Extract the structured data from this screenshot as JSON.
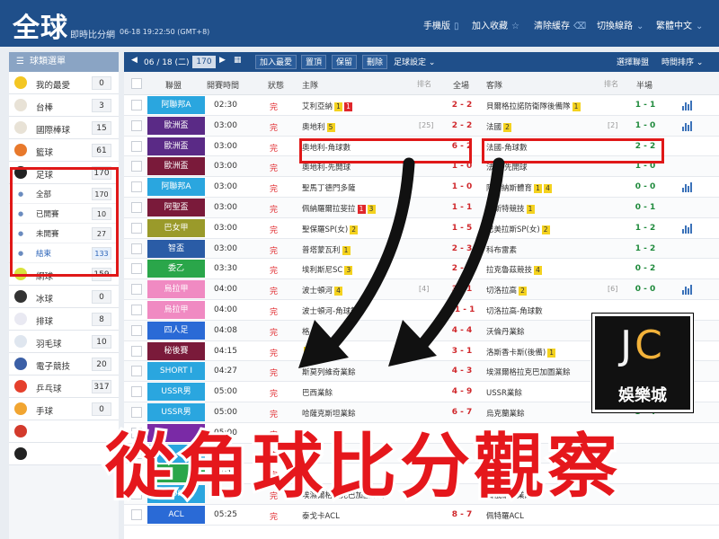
{
  "header": {
    "logo": "全球",
    "subtitle": "即時比分網",
    "datetime": "06-18 19:22:50 (GMT+8)",
    "nav": [
      {
        "label": "手機版",
        "icon": "mobile-icon"
      },
      {
        "label": "加入收藏",
        "icon": "star-icon"
      },
      {
        "label": "清除緩存",
        "icon": "clear-icon"
      },
      {
        "label": "切換線路",
        "icon": "chevron-down-icon"
      },
      {
        "label": "繁體中文",
        "icon": "chevron-down-icon"
      }
    ]
  },
  "sidebar": {
    "title": "球類選單",
    "items": [
      {
        "label": "我的最愛",
        "count": "0",
        "color": "#f3c623"
      },
      {
        "label": "台棒",
        "count": "3",
        "color": "#e8e2d6"
      },
      {
        "label": "國際棒球",
        "count": "15",
        "color": "#e8e2d6"
      },
      {
        "label": "籃球",
        "count": "61",
        "color": "#e8792c"
      },
      {
        "label": "足球",
        "count": "170",
        "color": "#222222"
      }
    ],
    "football_sub": [
      {
        "label": "全部",
        "count": "170"
      },
      {
        "label": "已開賽",
        "count": "10"
      },
      {
        "label": "未開賽",
        "count": "27"
      },
      {
        "label": "結束",
        "count": "133"
      }
    ],
    "items2": [
      {
        "label": "網球",
        "count": "159",
        "color": "#d9e23b"
      },
      {
        "label": "冰球",
        "count": "0",
        "color": "#333333"
      },
      {
        "label": "排球",
        "count": "8",
        "color": "#e9e9f2"
      },
      {
        "label": "羽毛球",
        "count": "10",
        "color": "#dfe6ef"
      },
      {
        "label": "電子競技",
        "count": "20",
        "color": "#3b5fa6"
      },
      {
        "label": "乒乓球",
        "count": "317",
        "color": "#e5402c"
      },
      {
        "label": "手球",
        "count": "0",
        "color": "#f1a531"
      },
      {
        "label": "",
        "count": "",
        "color": "#d33a2c"
      },
      {
        "label": "",
        "count": "",
        "color": "#222222"
      }
    ]
  },
  "toolbar": {
    "date": "06 / 18 (二)",
    "date_count": "170",
    "buttons": [
      "加入最愛",
      "置頂",
      "保留",
      "刪除"
    ],
    "settings": "足球設定",
    "select_league": "選擇聯盟",
    "sort": "時間排序"
  },
  "columns": {
    "league": "聯盟",
    "time": "開賽時間",
    "status": "狀態",
    "home": "主隊",
    "home_rank": "排名",
    "full": "全場",
    "away": "客隊",
    "away_rank": "排名",
    "half": "半場"
  },
  "matches": [
    {
      "league": "阿聯邦A",
      "league_color": "#2aa6df",
      "time": "02:30",
      "status": "完",
      "home": "艾利亞納",
      "home_cards": [
        {
          "t": "Y",
          "n": "1"
        },
        {
          "t": "R",
          "n": "1"
        }
      ],
      "home_rank": "",
      "score": "2 - 2",
      "away": "貝爾格拉諾防衛隊後備隊",
      "away_cards": [
        {
          "t": "Y",
          "n": "1"
        }
      ],
      "away_rank": "",
      "half": "1 - 1",
      "stat": true
    },
    {
      "league": "歐洲盃",
      "league_color": "#5a2a86",
      "time": "03:00",
      "status": "完",
      "home": "奧地利",
      "home_cards": [
        {
          "t": "Y",
          "n": "5"
        }
      ],
      "home_rank": "[25]",
      "score": "2 - 2",
      "away": "法國",
      "away_cards": [
        {
          "t": "Y",
          "n": "2"
        }
      ],
      "away_rank": "[2]",
      "half": "1 - 0",
      "stat": true
    },
    {
      "league": "歐洲盃",
      "league_color": "#5a2a86",
      "time": "03:00",
      "status": "完",
      "home": "奧地利-角球數",
      "home_cards": [],
      "home_rank": "",
      "score": "6 - 2",
      "away": "法國-角球數",
      "away_cards": [],
      "away_rank": "",
      "half": "2 - 2",
      "stat": false
    },
    {
      "league": "歐洲盃",
      "league_color": "#7a1a3a",
      "time": "03:00",
      "status": "完",
      "home": "奧地利-先開球",
      "home_cards": [],
      "home_rank": "",
      "score": "1 - 0",
      "away": "法國-先開球",
      "away_cards": [],
      "away_rank": "",
      "half": "1 - 0",
      "stat": false
    },
    {
      "league": "阿聯邦A",
      "league_color": "#2aa6df",
      "time": "03:00",
      "status": "完",
      "home": "聖馬丁德門多薩",
      "home_cards": [],
      "home_rank": "",
      "score": "1 - 0",
      "away": "阿爾納斯體育",
      "away_cards": [
        {
          "t": "Y",
          "n": "1"
        },
        {
          "t": "Y",
          "n": "4"
        }
      ],
      "away_rank": "",
      "half": "0 - 0",
      "stat": true
    },
    {
      "league": "阿聖盃",
      "league_color": "#7a1a3a",
      "time": "03:00",
      "status": "完",
      "home": "佩納羅爾拉斐拉",
      "home_cards": [
        {
          "t": "R",
          "n": "1"
        },
        {
          "t": "Y",
          "n": "3"
        }
      ],
      "home_rank": "",
      "score": "1 - 1",
      "away": "阿斯特競技",
      "away_cards": [
        {
          "t": "Y",
          "n": "1"
        }
      ],
      "away_rank": "",
      "half": "0 - 1",
      "stat": false
    },
    {
      "league": "巴女甲",
      "league_color": "#9a9a2a",
      "time": "03:00",
      "status": "完",
      "home": "聖保羅SP(女)",
      "home_cards": [
        {
          "t": "Y",
          "n": "2"
        }
      ],
      "home_rank": "",
      "score": "1 - 5",
      "away": "巴美拉斯SP(女)",
      "away_cards": [
        {
          "t": "Y",
          "n": "2"
        }
      ],
      "away_rank": "",
      "half": "1 - 2",
      "stat": true
    },
    {
      "league": "智盃",
      "league_color": "#2a5ca6",
      "time": "03:00",
      "status": "完",
      "home": "普塔蒙瓦利",
      "home_cards": [
        {
          "t": "Y",
          "n": "1"
        }
      ],
      "home_rank": "",
      "score": "2 - 3",
      "away": "科布雷素",
      "away_cards": [],
      "away_rank": "",
      "half": "1 - 2",
      "stat": false
    },
    {
      "league": "委乙",
      "league_color": "#2aa64a",
      "time": "03:30",
      "status": "完",
      "home": "埃利斯尼SC",
      "home_cards": [
        {
          "t": "Y",
          "n": "3"
        }
      ],
      "home_rank": "",
      "score": "2 - 2",
      "away": "拉克魯茲競技",
      "away_cards": [
        {
          "t": "Y",
          "n": "4"
        }
      ],
      "away_rank": "",
      "half": "0 - 2",
      "stat": false
    },
    {
      "league": "烏拉甲",
      "league_color": "#f08ac2",
      "time": "04:00",
      "status": "完",
      "home": "波士頓河",
      "home_cards": [
        {
          "t": "Y",
          "n": "4"
        }
      ],
      "home_rank": "[4]",
      "score": "3 - 1",
      "away": "切洛拉高",
      "away_cards": [
        {
          "t": "Y",
          "n": "2"
        }
      ],
      "away_rank": "[6]",
      "half": "0 - 0",
      "stat": true
    },
    {
      "league": "烏拉甲",
      "league_color": "#f08ac2",
      "time": "04:00",
      "status": "完",
      "home": "波士頓河-角球數",
      "home_cards": [],
      "home_rank": "",
      "score": "11 - 1",
      "away": "切洛拉高-角球數",
      "away_cards": [],
      "away_rank": "",
      "half": "",
      "stat": false
    },
    {
      "league": "四人足",
      "league_color": "#2a6ad6",
      "time": "04:08",
      "status": "完",
      "home": "格",
      "home_cards": [],
      "home_rank": "",
      "score": "4 - 4",
      "away": "沃倫丹業餘",
      "away_cards": [],
      "away_rank": "",
      "half": "",
      "stat": false
    },
    {
      "league": "秘後賽",
      "league_color": "#7a1a3a",
      "time": "04:15",
      "status": "完",
      "home": "",
      "home_cards": [
        {
          "t": "Y",
          "n": "4"
        }
      ],
      "home_rank": "",
      "score": "3 - 1",
      "away": "洛斯香卡斯(後備)",
      "away_cards": [
        {
          "t": "Y",
          "n": "1"
        }
      ],
      "away_rank": "",
      "half": "",
      "stat": false
    },
    {
      "league": "SHORT I",
      "league_color": "#2aa6df",
      "time": "04:27",
      "status": "完",
      "home": "斯莫列維奇業餘",
      "home_cards": [],
      "home_rank": "",
      "score": "4 - 3",
      "away": "埃濕爾格拉克巴加圖業餘",
      "away_cards": [],
      "away_rank": "",
      "half": "",
      "stat": false
    },
    {
      "league": "USSR男",
      "league_color": "#2aa6df",
      "time": "05:00",
      "status": "完",
      "home": "巴西業餘",
      "home_cards": [],
      "home_rank": "",
      "score": "4 - 9",
      "away": "USSR業餘",
      "away_cards": [],
      "away_rank": "",
      "half": "",
      "stat": false
    },
    {
      "league": "USSR男",
      "league_color": "#2aa6df",
      "time": "05:00",
      "status": "完",
      "home": "哈薩克斯坦業餘",
      "home_cards": [],
      "home_rank": "",
      "score": "6 - 7",
      "away": "烏克蘭業餘",
      "away_cards": [],
      "away_rank": "",
      "half": "3 - 4",
      "stat": false
    },
    {
      "league": "",
      "league_color": "#7a2aa6",
      "time": "05:00",
      "status": "完",
      "home": "",
      "home_cards": [],
      "home_rank": "",
      "score": "",
      "away": "",
      "away_cards": [],
      "away_rank": "",
      "half": "",
      "stat": false
    },
    {
      "league": "",
      "league_color": "#2aa6df",
      "time": "05:15",
      "status": "完",
      "home": "",
      "home_cards": [],
      "home_rank": "",
      "score": "",
      "away": "",
      "away_cards": [],
      "away_rank": "",
      "half": "",
      "stat": false
    },
    {
      "league": "",
      "league_color": "#2aa64a",
      "time": "05:15",
      "status": "完",
      "home": "",
      "home_cards": [],
      "home_rank": "",
      "score": "",
      "away": "",
      "away_cards": [],
      "away_rank": "",
      "half": "",
      "stat": false
    },
    {
      "league": "SHORT I",
      "league_color": "#2aa6df",
      "time": "05:15",
      "status": "完",
      "home": "埃濕爾格拉克巴加圖業餘",
      "home_cards": [],
      "home_rank": "",
      "score": "",
      "away": "白俄羅斯業餘",
      "away_cards": [],
      "away_rank": "",
      "half": "",
      "stat": false
    },
    {
      "league": "ACL",
      "league_color": "#2a6ad6",
      "time": "05:25",
      "status": "完",
      "home": "泰戈卡ACL",
      "home_cards": [],
      "home_rank": "",
      "score": "8 - 7",
      "away": "佩特羅ACL",
      "away_cards": [],
      "away_rank": "",
      "half": "",
      "stat": false
    }
  ],
  "watermark": {
    "mark_j": "J",
    "mark_c": "C",
    "name": "娛樂城"
  },
  "banner": {
    "text": "從角球比分觀察"
  }
}
